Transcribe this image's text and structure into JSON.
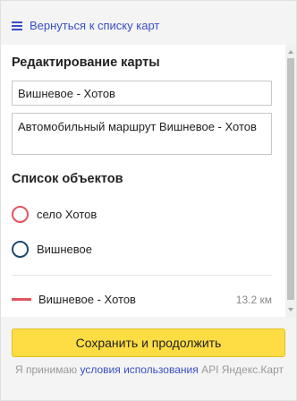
{
  "header": {
    "back_label": "Вернуться к списку карт"
  },
  "editor": {
    "title": "Редактирование карты",
    "map_name": "Вишневое -  Хотов",
    "map_description": "Автомобильный маршрут Вишневое -  Хотов"
  },
  "objects": {
    "title": "Список объектов",
    "points": [
      {
        "label": "село Хотов",
        "color": "#e0555e"
      },
      {
        "label": "Вишневое",
        "color": "#1e4a6e"
      }
    ],
    "routes": [
      {
        "label": "Вишневое - Хотов",
        "distance": "13.2 км",
        "color": "#e0555e"
      }
    ]
  },
  "footer": {
    "save_label": "Сохранить и продолжить",
    "terms_prefix": "Я принимаю",
    "terms_link": "условия использования",
    "terms_suffix": "API Яндекс.Карт"
  }
}
